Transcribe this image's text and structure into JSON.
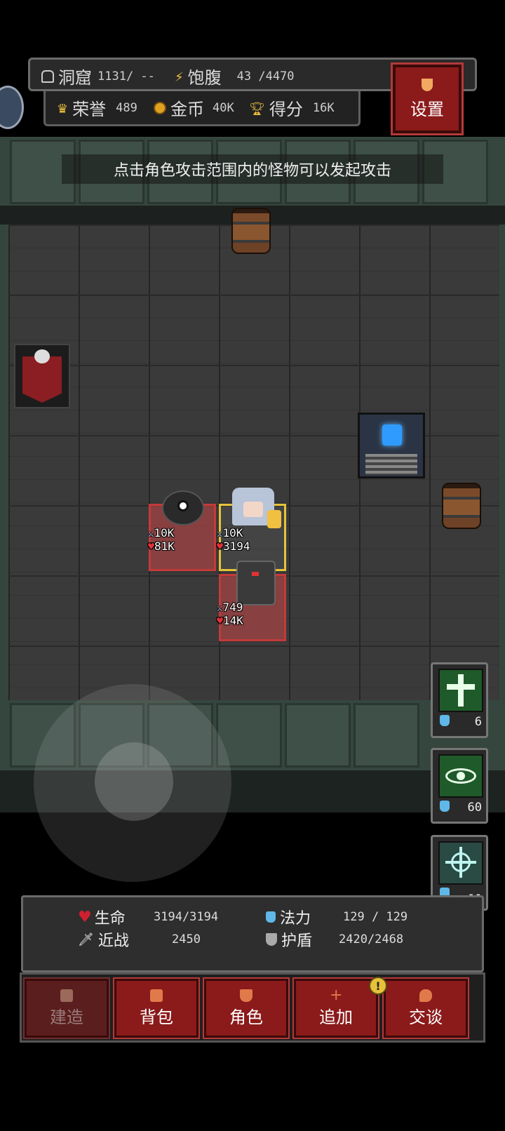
{
  "header": {
    "cave_label": "洞窟",
    "cave_value": "1131/ --",
    "hunger_label": "饱腹",
    "hunger_value": "43 /4470",
    "honor_label": "荣誉",
    "honor_value": "489",
    "gold_label": "金币",
    "gold_value": "40K",
    "score_label": "得分",
    "score_value": "16K",
    "settings_label": "设置"
  },
  "hint": "点击角色攻击范围内的怪物可以发起攻击",
  "units": [
    {
      "name": "monster",
      "attack": "10K",
      "hp": "81K"
    },
    {
      "name": "hero",
      "attack": "10K",
      "hp": "3194"
    },
    {
      "name": "knight",
      "attack": "749",
      "hp": "14K"
    }
  ],
  "skills": [
    {
      "icon": "holy-cross-icon",
      "cost": "6"
    },
    {
      "icon": "eye-icon",
      "cost": "60"
    },
    {
      "icon": "crosshair-icon",
      "cost": "--"
    }
  ],
  "stats": {
    "life_label": "生命",
    "life_value": "3194/3194",
    "mana_label": "法力",
    "mana_value": "129 / 129",
    "melee_label": "近战",
    "melee_value": "2450",
    "shield_label": "护盾",
    "shield_value": "2420/2468"
  },
  "nav": {
    "build": "建造",
    "bag": "背包",
    "character": "角色",
    "add": "追加",
    "talk": "交谈",
    "badge": "!"
  },
  "colors": {
    "button_red": "#8b1a1a",
    "selection_gold": "#e6c23a",
    "hp_red": "#e0303a",
    "mana_blue": "#5fb8e8"
  }
}
